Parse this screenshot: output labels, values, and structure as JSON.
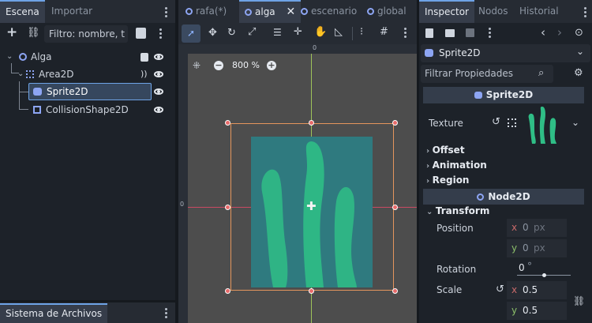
{
  "scene_panel": {
    "tabs": [
      "Escena",
      "Importar"
    ],
    "filter_placeholder": "Filtro: nombre, t",
    "nodes": [
      {
        "label": "Alga"
      },
      {
        "label": "Area2D"
      },
      {
        "label": "Sprite2D"
      },
      {
        "label": "CollisionShape2D"
      }
    ]
  },
  "filesystem_panel": {
    "title": "Sistema de Archivos"
  },
  "editor_tabs": [
    {
      "label": "rafa(*)"
    },
    {
      "label": "alga"
    },
    {
      "label": "escenario"
    },
    {
      "label": "global"
    }
  ],
  "viewport": {
    "zoom": "800 %",
    "ruler_label": "0",
    "ruler_left_label": "0"
  },
  "inspector": {
    "tabs": [
      "Inspector",
      "Nodos",
      "Historial"
    ],
    "node_type": "Sprite2D",
    "filter_placeholder": "Filtrar Propiedades",
    "class_header": "Sprite2D",
    "texture_label": "Texture",
    "sections": [
      "Offset",
      "Animation",
      "Region"
    ],
    "node2d_header": "Node2D",
    "transform_label": "Transform",
    "position_label": "Position",
    "position_x": "0",
    "position_y": "0",
    "x_axis": "x",
    "y_axis": "y",
    "px_unit": "px",
    "rotation_label": "Rotation",
    "rotation_value": "0",
    "rotation_unit": "°",
    "rotation_fraction": 0.5,
    "scale_label": "Scale",
    "scale_x": "0.5",
    "scale_y": "0.5"
  },
  "colors": {
    "accent": "#6ea3e6",
    "panel_bg": "#1d2229",
    "toolbar_bg": "#262b33",
    "viewport_bg": "#4d4d4d",
    "selection_outline": "#e4955d",
    "sprite_rect": "#2f7a7f",
    "seaweed": "#2fbe86"
  }
}
